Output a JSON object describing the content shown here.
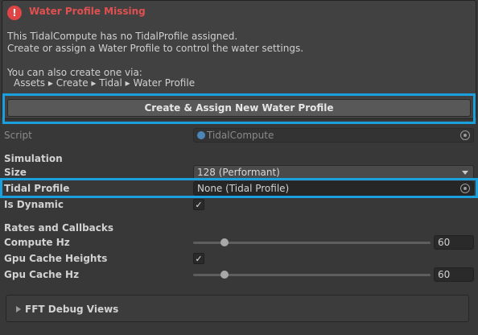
{
  "help_box": {
    "title": "Water Profile Missing",
    "line1": "This TidalCompute has no TidalProfile assigned.",
    "line2": "Create or assign a Water Profile to control the water settings.",
    "line3": "You can also create one via:",
    "line4": "Assets ▸ Create ▸ Tidal ▸ Water Profile"
  },
  "create_button": {
    "label": "Create & Assign New Water Profile"
  },
  "script_row": {
    "label": "Script",
    "value": "TidalCompute"
  },
  "simulation": {
    "header": "Simulation",
    "size_label": "Size",
    "size_value": "128 (Performant)",
    "tidal_profile_label": "Tidal Profile",
    "tidal_profile_value": "None (Tidal Profile)",
    "is_dynamic_label": "Is Dynamic",
    "is_dynamic_checked": "✓"
  },
  "rates": {
    "header": "Rates and Callbacks",
    "compute_hz_label": "Compute Hz",
    "compute_hz_value": "60",
    "compute_hz_slider_fraction": 0.12,
    "gpu_cache_heights_label": "Gpu Cache Heights",
    "gpu_cache_heights_checked": "✓",
    "gpu_cache_hz_label": "Gpu Cache Hz",
    "gpu_cache_hz_value": "60",
    "gpu_cache_hz_slider_fraction": 0.12
  },
  "fft_debug": {
    "label": "FFT Debug Views"
  },
  "colors": {
    "highlight": "#1aa0dc",
    "error": "#e04545"
  },
  "icons": {
    "error": "error-icon",
    "picker": "object-picker-icon",
    "dropdown": "chevron-down-icon",
    "foldout": "foldout-triangle-icon"
  }
}
